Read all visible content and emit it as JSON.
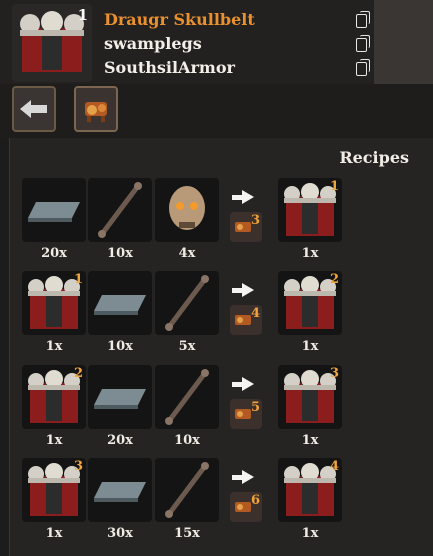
{
  "header": {
    "main_item_quality": "1",
    "items": [
      {
        "name": "Draugr Skullbelt",
        "selected": true
      },
      {
        "name": "swamplegs",
        "selected": false
      },
      {
        "name": "SouthsilArmor",
        "selected": false
      }
    ]
  },
  "panel": {
    "title": "Recipes",
    "recipes": [
      {
        "ingredients": [
          {
            "icon": "metal-bar-icon",
            "qty": "20x"
          },
          {
            "icon": "bone-rod-icon",
            "qty": "10x"
          },
          {
            "icon": "skull-icon",
            "qty": "4x"
          }
        ],
        "station_level": "3",
        "result": {
          "icon": "skullbelt-icon",
          "quality": "1",
          "qty": "1x"
        }
      },
      {
        "ingredients": [
          {
            "icon": "skullbelt-icon",
            "qty": "1x",
            "quality": "1"
          },
          {
            "icon": "metal-bar-icon",
            "qty": "10x"
          },
          {
            "icon": "bone-rod-icon",
            "qty": "5x"
          }
        ],
        "station_level": "4",
        "result": {
          "icon": "skullbelt-icon",
          "quality": "2",
          "qty": "1x"
        }
      },
      {
        "ingredients": [
          {
            "icon": "skullbelt-icon",
            "qty": "1x",
            "quality": "2"
          },
          {
            "icon": "metal-bar-icon",
            "qty": "20x"
          },
          {
            "icon": "bone-rod-icon",
            "qty": "10x"
          }
        ],
        "station_level": "5",
        "result": {
          "icon": "skullbelt-icon",
          "quality": "3",
          "qty": "1x"
        }
      },
      {
        "ingredients": [
          {
            "icon": "skullbelt-icon",
            "qty": "1x",
            "quality": "3"
          },
          {
            "icon": "metal-bar-icon",
            "qty": "30x"
          },
          {
            "icon": "bone-rod-icon",
            "qty": "15x"
          }
        ],
        "station_level": "6",
        "result": {
          "icon": "skullbelt-icon",
          "quality": "4",
          "qty": "1x"
        }
      }
    ]
  },
  "colors": {
    "selected_name": "#e9902f",
    "quality_badge": "#f0a63a"
  }
}
